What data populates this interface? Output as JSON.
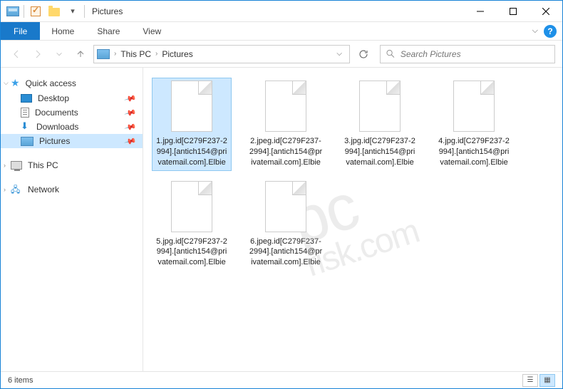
{
  "titlebar": {
    "title": "Pictures"
  },
  "ribbon": {
    "file": "File",
    "tabs": [
      "Home",
      "Share",
      "View"
    ]
  },
  "breadcrumb": {
    "items": [
      "This PC",
      "Pictures"
    ]
  },
  "search": {
    "placeholder": "Search Pictures"
  },
  "sidebar": {
    "quick_access": "Quick access",
    "items": [
      {
        "label": "Desktop",
        "pinned": true
      },
      {
        "label": "Documents",
        "pinned": true
      },
      {
        "label": "Downloads",
        "pinned": true
      },
      {
        "label": "Pictures",
        "pinned": true,
        "selected": true
      }
    ],
    "this_pc": "This PC",
    "network": "Network"
  },
  "files": [
    {
      "name": "1.jpg.id[C279F237-2994].[antich154@privatemail.com].Elbie",
      "selected": true
    },
    {
      "name": "2.jpeg.id[C279F237-2994].[antich154@privatemail.com].Elbie"
    },
    {
      "name": "3.jpg.id[C279F237-2994].[antich154@privatemail.com].Elbie"
    },
    {
      "name": "4.jpg.id[C279F237-2994].[antich154@privatemail.com].Elbie"
    },
    {
      "name": "5.jpg.id[C279F237-2994].[antich154@privatemail.com].Elbie"
    },
    {
      "name": "6.jpeg.id[C279F237-2994].[antich154@privatemail.com].Elbie"
    }
  ],
  "statusbar": {
    "count": "6 items"
  },
  "watermark": {
    "main": "pc",
    "sub": "risk.com"
  }
}
